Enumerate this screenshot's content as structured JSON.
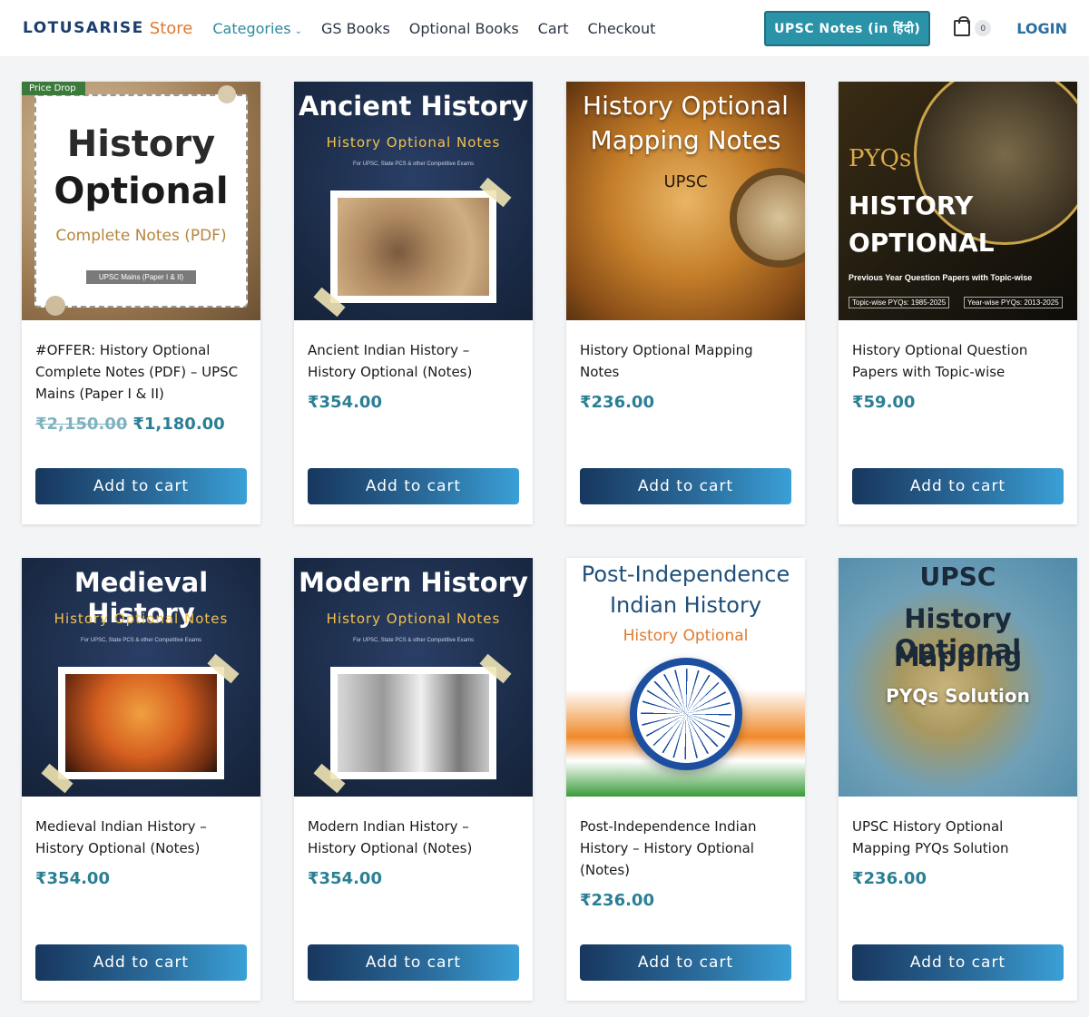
{
  "header": {
    "logo_main": "LOTUSARISE",
    "logo_store": "Store",
    "nav": [
      {
        "label": "Categories",
        "active": true,
        "dropdown": true
      },
      {
        "label": "GS Books"
      },
      {
        "label": "Optional Books"
      },
      {
        "label": "Cart"
      },
      {
        "label": "Checkout"
      }
    ],
    "upsc_button": "UPSC Notes (in हिंदी)",
    "cart_count": "0",
    "login": "LOGIN"
  },
  "products": [
    {
      "badge": "Price Drop",
      "thumb": {
        "line1": "History",
        "line2": "Optional",
        "line3": "Complete Notes (PDF)",
        "line4": "UPSC Mains (Paper I & II)"
      },
      "title": "#OFFER: History Optional Complete Notes (PDF) – UPSC Mains (Paper I & II)",
      "old_price": "₹2,150.00",
      "price": "₹1,180.00",
      "button": "Add to cart"
    },
    {
      "thumb": {
        "line1": "Ancient History",
        "line2": "History Optional Notes",
        "line3": "For UPSC, State PCS & other Competitive Exams"
      },
      "title": "Ancient Indian History – History Optional (Notes)",
      "price": "₹354.00",
      "button": "Add to cart"
    },
    {
      "thumb": {
        "line1": "History Optional",
        "line2": "Mapping Notes",
        "line3": "UPSC"
      },
      "title": "History Optional Mapping Notes",
      "price": "₹236.00",
      "button": "Add to cart"
    },
    {
      "thumb": {
        "line1": "PYQs",
        "line2": "HISTORY",
        "line3": "OPTIONAL",
        "line4": "Previous Year Question Papers with Topic-wise",
        "line5": "Topic-wise PYQs: 1985-2025",
        "line6": "Year-wise PYQs: 2013-2025"
      },
      "title": "History Optional Question Papers with Topic-wise",
      "price": "₹59.00",
      "button": "Add to cart"
    },
    {
      "thumb": {
        "line1": "Medieval History",
        "line2": "History Optional Notes",
        "line3": "For UPSC, State PCS & other Competitive Exams"
      },
      "title": "Medieval Indian History – History Optional (Notes)",
      "price": "₹354.00",
      "button": "Add to cart"
    },
    {
      "thumb": {
        "line1": "Modern History",
        "line2": "History Optional Notes",
        "line3": "For UPSC, State PCS & other Competitive Exams"
      },
      "title": "Modern Indian History – History Optional (Notes)",
      "price": "₹354.00",
      "button": "Add to cart"
    },
    {
      "thumb": {
        "line1": "Post-Independence",
        "line2": "Indian History",
        "line3": "History Optional"
      },
      "title": "Post-Independence Indian History – History Optional (Notes)",
      "price": "₹236.00",
      "button": "Add to cart"
    },
    {
      "thumb": {
        "line1": "UPSC",
        "line2": "History Optional",
        "line3": "Mapping",
        "line4": "PYQs Solution"
      },
      "title": "UPSC History Optional Mapping PYQs Solution",
      "price": "₹236.00",
      "button": "Add to cart"
    }
  ]
}
